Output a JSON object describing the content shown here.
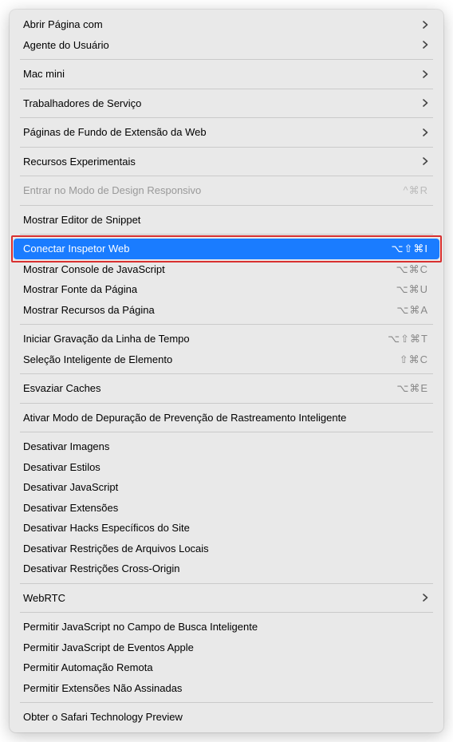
{
  "menu": {
    "sections": [
      [
        {
          "id": "open-with",
          "label": "Abrir Página com",
          "submenu": true
        },
        {
          "id": "user-agent",
          "label": "Agente do Usuário",
          "submenu": true
        }
      ],
      [
        {
          "id": "mac-mini",
          "label": "Mac mini",
          "submenu": true
        }
      ],
      [
        {
          "id": "service-workers",
          "label": "Trabalhadores de Serviço",
          "submenu": true
        }
      ],
      [
        {
          "id": "extension-bg",
          "label": "Páginas de Fundo de Extensão da Web",
          "submenu": true
        }
      ],
      [
        {
          "id": "experimental",
          "label": "Recursos Experimentais",
          "submenu": true
        }
      ],
      [
        {
          "id": "responsive",
          "label": "Entrar no Modo de Design Responsivo",
          "shortcut": "^⌘R",
          "disabled": true
        }
      ],
      [
        {
          "id": "snippet-editor",
          "label": "Mostrar Editor de Snippet"
        }
      ],
      [
        {
          "id": "web-inspector",
          "label": "Conectar Inspetor Web",
          "shortcut": "⌥⇧⌘I",
          "selected": true,
          "highlighted": true
        },
        {
          "id": "js-console",
          "label": "Mostrar Console de JavaScript",
          "shortcut": "⌥⌘C"
        },
        {
          "id": "page-source",
          "label": "Mostrar Fonte da Página",
          "shortcut": "⌥⌘U"
        },
        {
          "id": "page-resources",
          "label": "Mostrar Recursos da Página",
          "shortcut": "⌥⌘A"
        }
      ],
      [
        {
          "id": "timeline",
          "label": "Iniciar Gravação da Linha de Tempo",
          "shortcut": "⌥⇧⌘T"
        },
        {
          "id": "element-select",
          "label": "Seleção Inteligente de Elemento",
          "shortcut": "⇧⌘C"
        }
      ],
      [
        {
          "id": "empty-caches",
          "label": "Esvaziar Caches",
          "shortcut": "⌥⌘E"
        }
      ],
      [
        {
          "id": "tracking-debug",
          "label": "Ativar Modo de Depuração de Prevenção de Rastreamento Inteligente"
        }
      ],
      [
        {
          "id": "disable-images",
          "label": "Desativar Imagens"
        },
        {
          "id": "disable-styles",
          "label": "Desativar Estilos"
        },
        {
          "id": "disable-js",
          "label": "Desativar JavaScript"
        },
        {
          "id": "disable-extensions",
          "label": "Desativar Extensões"
        },
        {
          "id": "disable-site-hacks",
          "label": "Desativar Hacks Específicos do Site"
        },
        {
          "id": "disable-local-files",
          "label": "Desativar Restrições de Arquivos Locais"
        },
        {
          "id": "disable-cross-origin",
          "label": "Desativar Restrições Cross-Origin"
        }
      ],
      [
        {
          "id": "webrtc",
          "label": "WebRTC",
          "submenu": true
        }
      ],
      [
        {
          "id": "allow-js-search",
          "label": "Permitir JavaScript no Campo de Busca Inteligente"
        },
        {
          "id": "allow-js-apple-events",
          "label": "Permitir JavaScript de Eventos Apple"
        },
        {
          "id": "allow-remote-automation",
          "label": "Permitir Automação Remota"
        },
        {
          "id": "allow-unsigned-ext",
          "label": "Permitir Extensões Não Assinadas"
        }
      ],
      [
        {
          "id": "tech-preview",
          "label": "Obter o Safari Technology Preview"
        }
      ]
    ]
  }
}
